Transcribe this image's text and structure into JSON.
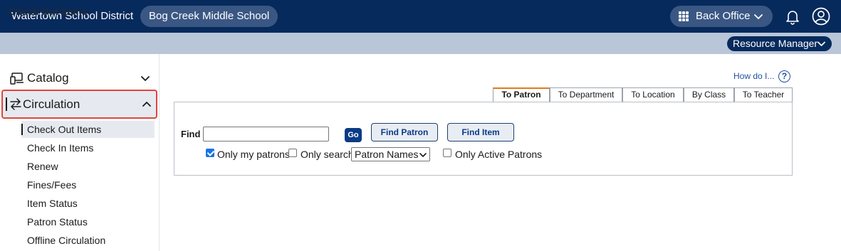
{
  "header": {
    "district": "Watertown School District",
    "school": "Bog Creek Middle School",
    "back_office": "Back Office"
  },
  "subheader": {
    "page_title": "Check Out Items",
    "resource_manager": "Resource Manager"
  },
  "sidebar": {
    "catalog": "Catalog",
    "circulation": "Circulation",
    "items": [
      "Check Out Items",
      "Check In Items",
      "Renew",
      "Fines/Fees",
      "Item Status",
      "Patron Status",
      "Offline Circulation"
    ],
    "active_index": 0
  },
  "main": {
    "help_text": "How do I...",
    "help_icon": "?",
    "tabs": [
      "To Patron",
      "To Department",
      "To Location",
      "By Class",
      "To Teacher"
    ],
    "active_tab": 0,
    "find_label": "Find",
    "find_value": "",
    "go_label": "Go",
    "find_patron": "Find Patron",
    "find_item": "Find Item",
    "only_my_patrons": "Only my patrons",
    "only_my_patrons_checked": true,
    "only_search": "Only search",
    "only_search_checked": false,
    "search_select": "Patron Names",
    "only_active": "Only Active Patrons",
    "only_active_checked": false
  },
  "colors": {
    "topbar": "#062a5c",
    "pill": "#3a5784",
    "subbar": "#b8c6d8",
    "highlight_border": "#e0453a",
    "active_tab_accent": "#e07a1f",
    "link": "#1f4f9e"
  }
}
